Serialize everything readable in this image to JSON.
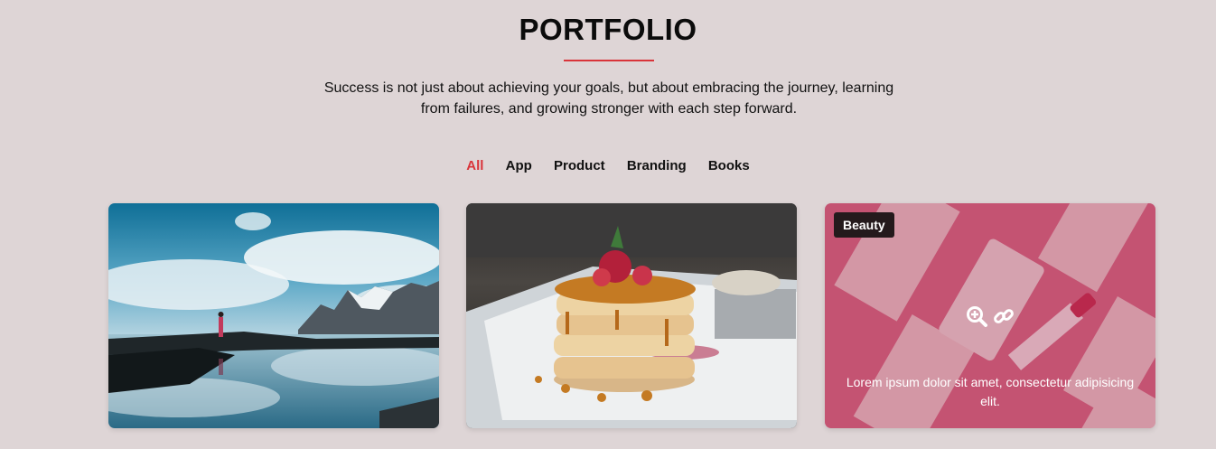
{
  "section": {
    "title": "PORTFOLIO",
    "subtitle": "Success is not just about achieving your goals, but about embracing the journey, learning from failures, and growing stronger with each step forward."
  },
  "filters": [
    {
      "label": "All",
      "active": true
    },
    {
      "label": "App",
      "active": false
    },
    {
      "label": "Product",
      "active": false
    },
    {
      "label": "Branding",
      "active": false
    },
    {
      "label": "Books",
      "active": false
    }
  ],
  "items": [
    {
      "image": "mountain-lake-reflection"
    },
    {
      "image": "pancake-stack-with-strawberries"
    },
    {
      "image": "pink-cosmetic-tubes",
      "category": "Beauty",
      "caption": "Lorem ipsum dolor sit amet, consectetur adipisicing elit."
    }
  ],
  "colors": {
    "accent": "#d9343a",
    "background": "#ded5d6"
  }
}
